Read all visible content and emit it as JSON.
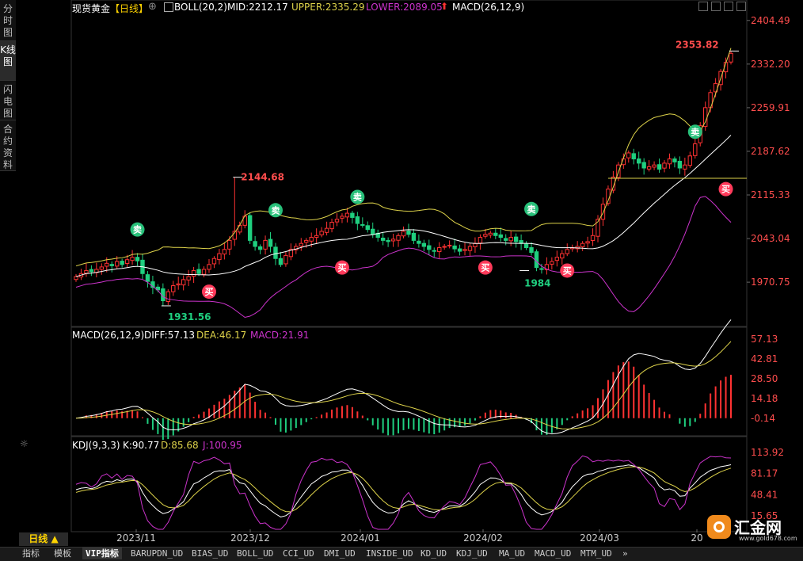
{
  "left_tabs": [
    {
      "label": "分时图"
    },
    {
      "label": "K线图"
    },
    {
      "label": "闪电图"
    },
    {
      "label": "合约资料"
    }
  ],
  "header": {
    "symbol": "现货黄金",
    "period": "【日线】",
    "boll_label": "BOLL(20,2)",
    "mid": "MID:2212.17",
    "upper": "UPPER:2335.29",
    "lower": "LOWER:2089.05",
    "macd_label": "MACD(26,12,9)"
  },
  "macd_header": {
    "label": "MACD(26,12,9)",
    "diff": "DIFF:57.13",
    "dea": "DEA:46.17",
    "macd": "MACD:21.91"
  },
  "kdj_header": {
    "label": "KDJ(9,3,3)",
    "k": "K:90.77",
    "d": "D:85.68",
    "j": "J:100.95"
  },
  "bottom_tabs": [
    "指标",
    "模板",
    "VIP指标",
    "BARUPDN_UD",
    "BIAS_UD",
    "BOLL_UD",
    "CCI_UD",
    "DMI_UD",
    "INSIDE_UD",
    "KD_UD",
    "KDJ_UD",
    "MA_UD",
    "MACD_UD",
    "MTM_UD",
    "»"
  ],
  "period_button": "日线 ▲",
  "logo": {
    "text": "汇金网",
    "url": "www.gold678.com"
  },
  "colors": {
    "up": "#ff3232",
    "down": "#1fcf7f",
    "boll_upper": "#ddd24a",
    "boll_mid": "#ffffff",
    "boll_lower": "#cc33cc",
    "diff": "#ffffff",
    "dea": "#ddd24a",
    "macd": "#cc33cc",
    "price_axis": "#ff4d4d",
    "date_axis": "#cccccc"
  },
  "chart_data": [
    {
      "type": "candlestick",
      "title": "现货黄金【日线】",
      "ylim": [
        1900,
        2420
      ],
      "y_ticks": [
        "2404.49",
        "2332.20",
        "2259.91",
        "2187.62",
        "2115.33",
        "2043.04",
        "1970.75"
      ],
      "x_ticks": [
        "2023/11",
        "2023/12",
        "2024/01",
        "2024/02",
        "2024/03",
        "20"
      ],
      "annotations": [
        {
          "text": "2353.82",
          "kind": "high"
        },
        {
          "text": "2144.68",
          "kind": "high"
        },
        {
          "text": "1931.56",
          "kind": "low"
        },
        {
          "text": "1984",
          "kind": "low"
        }
      ],
      "signals": [
        {
          "label": "卖",
          "type": "sell"
        },
        {
          "label": "卖",
          "type": "sell"
        },
        {
          "label": "卖",
          "type": "sell"
        },
        {
          "label": "卖",
          "type": "sell"
        },
        {
          "label": "卖",
          "type": "sell"
        },
        {
          "label": "买",
          "type": "buy"
        },
        {
          "label": "买",
          "type": "buy"
        },
        {
          "label": "买",
          "type": "buy"
        },
        {
          "label": "买",
          "type": "buy"
        },
        {
          "label": "买",
          "type": "buy"
        }
      ],
      "close": [
        1980,
        1985,
        1990,
        1988,
        1992,
        1996,
        2002,
        1998,
        2005,
        2000,
        2008,
        2012,
        2006,
        1985,
        1972,
        1962,
        1958,
        1940,
        1955,
        1965,
        1968,
        1975,
        1980,
        1990,
        1985,
        1992,
        2000,
        2010,
        2018,
        2025,
        2040,
        2055,
        2065,
        2080,
        2040,
        2030,
        2025,
        2040,
        2030,
        2010,
        2000,
        2015,
        2025,
        2030,
        2035,
        2040,
        2045,
        2048,
        2055,
        2060,
        2070,
        2075,
        2080,
        2085,
        2078,
        2068,
        2065,
        2058,
        2050,
        2045,
        2040,
        2038,
        2042,
        2048,
        2055,
        2050,
        2040,
        2035,
        2030,
        2025,
        2022,
        2028,
        2030,
        2032,
        2026,
        2022,
        2025,
        2030,
        2035,
        2045,
        2050,
        2052,
        2048,
        2045,
        2040,
        2045,
        2038,
        2035,
        2028,
        2020,
        1995,
        1992,
        2000,
        2005,
        2012,
        2018,
        2025,
        2028,
        2030,
        2035,
        2038,
        2048,
        2075,
        2100,
        2125,
        2145,
        2165,
        2175,
        2185,
        2175,
        2168,
        2160,
        2162,
        2165,
        2158,
        2168,
        2175,
        2170,
        2160,
        2165,
        2180,
        2200,
        2230,
        2260,
        2285,
        2300,
        2320,
        2335,
        2350
      ]
    },
    {
      "type": "line",
      "title": "MACD(26,12,9)",
      "y_ticks": [
        "57.13",
        "42.81",
        "28.50",
        "14.18",
        "-0.14"
      ],
      "series": [
        {
          "name": "DIFF",
          "values": []
        },
        {
          "name": "DEA",
          "values": []
        },
        {
          "name": "MACD",
          "values": []
        }
      ]
    },
    {
      "type": "line",
      "title": "KDJ(9,3,3)",
      "y_ticks": [
        "113.92",
        "81.17",
        "48.41",
        "15.65"
      ],
      "series": [
        {
          "name": "K",
          "values": []
        },
        {
          "name": "D",
          "values": []
        },
        {
          "name": "J",
          "values": []
        }
      ]
    }
  ]
}
